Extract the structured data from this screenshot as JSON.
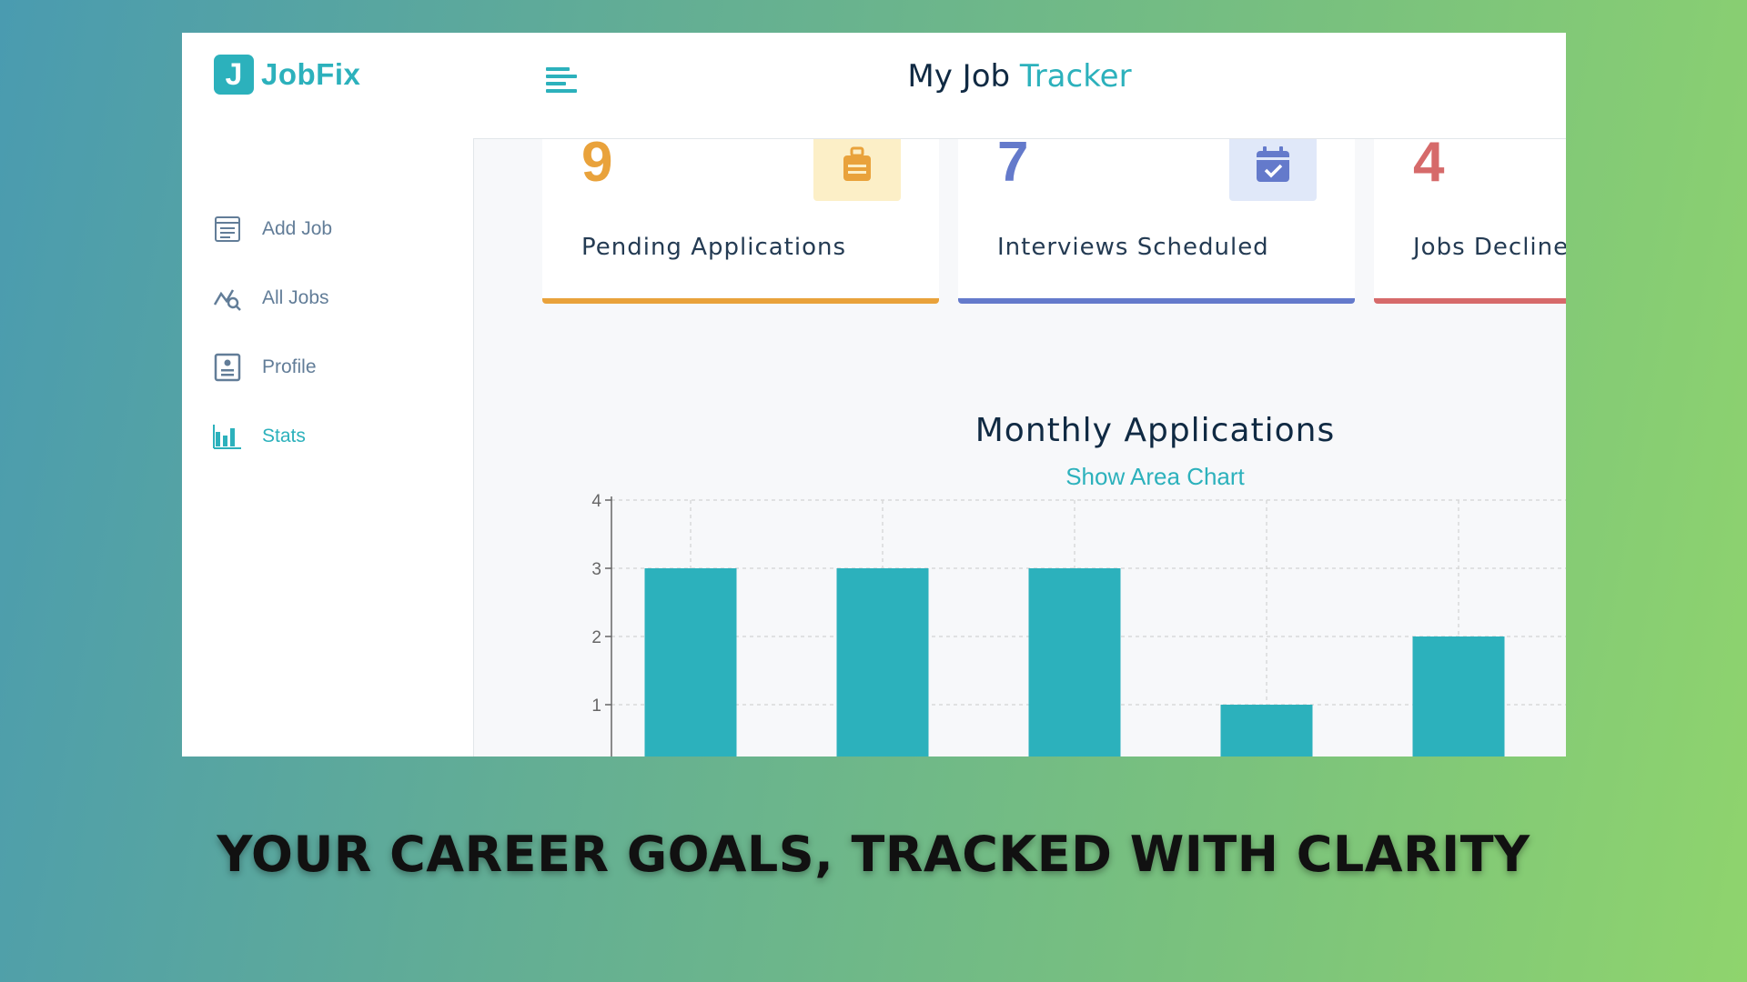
{
  "brand": {
    "logo_letter": "J",
    "name": "JobFix"
  },
  "header": {
    "title_main": "My Job",
    "title_accent": "Tracker"
  },
  "sidebar": {
    "items": [
      {
        "label": "Add Job",
        "icon": "form-icon",
        "active": false
      },
      {
        "label": "All Jobs",
        "icon": "chart-search-icon",
        "active": false
      },
      {
        "label": "Profile",
        "icon": "id-card-icon",
        "active": false
      },
      {
        "label": "Stats",
        "icon": "bar-chart-icon",
        "active": true
      }
    ]
  },
  "stats": [
    {
      "count": "9",
      "label": "Pending Applications",
      "icon": "suitcase-icon",
      "color": "#e9a23b",
      "bg": "#fcefc7"
    },
    {
      "count": "7",
      "label": "Interviews Scheduled",
      "icon": "calendar-check-icon",
      "color": "#647acb",
      "bg": "#e0e8f9"
    },
    {
      "count": "4",
      "label": "Jobs Declined",
      "icon": "bug-icon",
      "color": "#d66a6a",
      "bg": "#ffeeee"
    }
  ],
  "chart": {
    "heading": "Monthly Applications",
    "toggle_label": "Show Area Chart"
  },
  "chart_data": {
    "type": "bar",
    "title": "Monthly Applications",
    "categories": [
      "",
      "",
      "",
      "",
      ""
    ],
    "values": [
      3,
      3,
      3,
      1,
      2
    ],
    "yticks": [
      1,
      2,
      3,
      4
    ],
    "ylim": [
      0,
      4
    ],
    "grid": true,
    "bar_color": "#2cb1bc"
  },
  "caption": "YOUR CAREER GOALS, TRACKED WITH CLARITY"
}
